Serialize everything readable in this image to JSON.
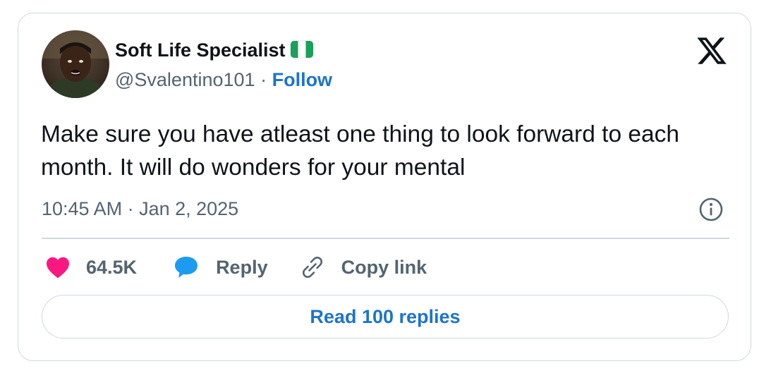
{
  "author": {
    "display_name": "Soft Life Specialist",
    "flag_icon": "nigeria-flag-icon",
    "handle": "@Svalentino101",
    "separator": "·",
    "follow_label": "Follow"
  },
  "platform_icon": "x-logo-icon",
  "tweet": {
    "text": "Make sure you have atleast one thing to look forward to each month. It will do wonders for your mental",
    "timestamp": "10:45 AM · Jan 2, 2025"
  },
  "actions": {
    "like_count": "64.5K",
    "reply_label": "Reply",
    "copy_link_label": "Copy link"
  },
  "read_replies_label": "Read 100 replies",
  "colors": {
    "follow_blue": "#1d74c9",
    "like_pink": "#f91880",
    "reply_blue": "#1d9bf0",
    "border_gray": "#cfd9de",
    "secondary_text": "#536471",
    "primary_text": "#0f1419",
    "flag_green": "#1aa05a"
  }
}
